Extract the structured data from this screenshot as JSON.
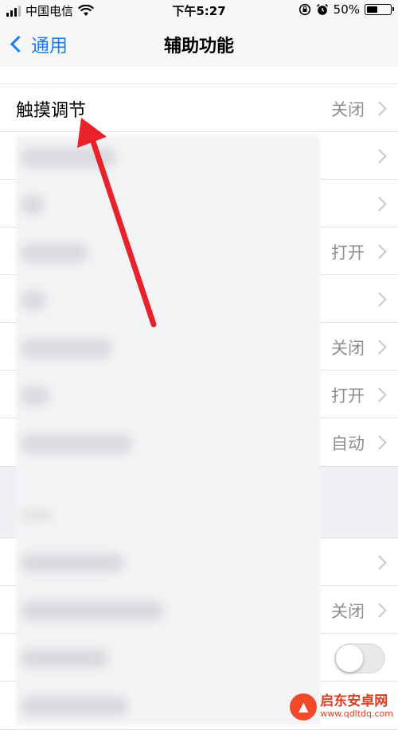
{
  "status_bar": {
    "carrier": "中国电信",
    "time": "下午5:27",
    "battery_percent": "50%",
    "battery_level": 0.5,
    "icons": [
      "signal-icon",
      "wifi-icon",
      "rotation-lock-icon",
      "alarm-icon",
      "battery-icon"
    ]
  },
  "nav": {
    "back_label": "通用",
    "title": "辅助功能"
  },
  "rows": [
    {
      "label": "触摸调节",
      "value": "关闭"
    },
    {
      "label": "",
      "value": ""
    },
    {
      "label": "",
      "value": ""
    },
    {
      "label": "",
      "value": "打开"
    },
    {
      "label": "",
      "value": ""
    },
    {
      "label": "",
      "value": "关闭"
    },
    {
      "label": "",
      "value": "打开"
    },
    {
      "label": "",
      "value": "自动"
    }
  ],
  "rows2": [
    {
      "label": "",
      "value": ""
    },
    {
      "label": "",
      "value": "关闭"
    },
    {
      "label": "",
      "value": "",
      "toggle_on": false
    },
    {
      "label": "",
      "value": ""
    }
  ],
  "annotation": {
    "type": "red-arrow",
    "color": "#e8212b"
  },
  "watermark": {
    "name": "启东安卓网",
    "url": "www.qdltdq.com"
  },
  "colors": {
    "accent": "#1a7cf5",
    "background": "#efeff4",
    "secondary_text": "#8e8e93"
  }
}
